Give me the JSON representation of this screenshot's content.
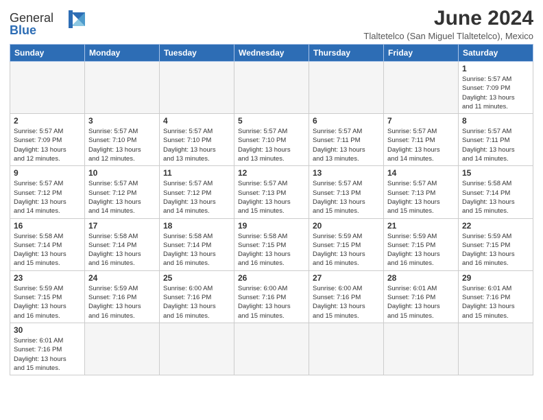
{
  "header": {
    "logo_text_general": "General",
    "logo_text_blue": "Blue",
    "month_year": "June 2024",
    "location": "Tlaltetelco (San Miguel Tlaltetelco), Mexico"
  },
  "weekdays": [
    "Sunday",
    "Monday",
    "Tuesday",
    "Wednesday",
    "Thursday",
    "Friday",
    "Saturday"
  ],
  "weeks": [
    [
      {
        "day": "",
        "info": ""
      },
      {
        "day": "",
        "info": ""
      },
      {
        "day": "",
        "info": ""
      },
      {
        "day": "",
        "info": ""
      },
      {
        "day": "",
        "info": ""
      },
      {
        "day": "",
        "info": ""
      },
      {
        "day": "1",
        "info": "Sunrise: 5:57 AM\nSunset: 7:09 PM\nDaylight: 13 hours\nand 11 minutes."
      }
    ],
    [
      {
        "day": "2",
        "info": "Sunrise: 5:57 AM\nSunset: 7:09 PM\nDaylight: 13 hours\nand 12 minutes."
      },
      {
        "day": "3",
        "info": "Sunrise: 5:57 AM\nSunset: 7:10 PM\nDaylight: 13 hours\nand 12 minutes."
      },
      {
        "day": "4",
        "info": "Sunrise: 5:57 AM\nSunset: 7:10 PM\nDaylight: 13 hours\nand 13 minutes."
      },
      {
        "day": "5",
        "info": "Sunrise: 5:57 AM\nSunset: 7:10 PM\nDaylight: 13 hours\nand 13 minutes."
      },
      {
        "day": "6",
        "info": "Sunrise: 5:57 AM\nSunset: 7:11 PM\nDaylight: 13 hours\nand 13 minutes."
      },
      {
        "day": "7",
        "info": "Sunrise: 5:57 AM\nSunset: 7:11 PM\nDaylight: 13 hours\nand 14 minutes."
      },
      {
        "day": "8",
        "info": "Sunrise: 5:57 AM\nSunset: 7:11 PM\nDaylight: 13 hours\nand 14 minutes."
      }
    ],
    [
      {
        "day": "9",
        "info": "Sunrise: 5:57 AM\nSunset: 7:12 PM\nDaylight: 13 hours\nand 14 minutes."
      },
      {
        "day": "10",
        "info": "Sunrise: 5:57 AM\nSunset: 7:12 PM\nDaylight: 13 hours\nand 14 minutes."
      },
      {
        "day": "11",
        "info": "Sunrise: 5:57 AM\nSunset: 7:12 PM\nDaylight: 13 hours\nand 14 minutes."
      },
      {
        "day": "12",
        "info": "Sunrise: 5:57 AM\nSunset: 7:13 PM\nDaylight: 13 hours\nand 15 minutes."
      },
      {
        "day": "13",
        "info": "Sunrise: 5:57 AM\nSunset: 7:13 PM\nDaylight: 13 hours\nand 15 minutes."
      },
      {
        "day": "14",
        "info": "Sunrise: 5:57 AM\nSunset: 7:13 PM\nDaylight: 13 hours\nand 15 minutes."
      },
      {
        "day": "15",
        "info": "Sunrise: 5:58 AM\nSunset: 7:14 PM\nDaylight: 13 hours\nand 15 minutes."
      }
    ],
    [
      {
        "day": "16",
        "info": "Sunrise: 5:58 AM\nSunset: 7:14 PM\nDaylight: 13 hours\nand 15 minutes."
      },
      {
        "day": "17",
        "info": "Sunrise: 5:58 AM\nSunset: 7:14 PM\nDaylight: 13 hours\nand 16 minutes."
      },
      {
        "day": "18",
        "info": "Sunrise: 5:58 AM\nSunset: 7:14 PM\nDaylight: 13 hours\nand 16 minutes."
      },
      {
        "day": "19",
        "info": "Sunrise: 5:58 AM\nSunset: 7:15 PM\nDaylight: 13 hours\nand 16 minutes."
      },
      {
        "day": "20",
        "info": "Sunrise: 5:59 AM\nSunset: 7:15 PM\nDaylight: 13 hours\nand 16 minutes."
      },
      {
        "day": "21",
        "info": "Sunrise: 5:59 AM\nSunset: 7:15 PM\nDaylight: 13 hours\nand 16 minutes."
      },
      {
        "day": "22",
        "info": "Sunrise: 5:59 AM\nSunset: 7:15 PM\nDaylight: 13 hours\nand 16 minutes."
      }
    ],
    [
      {
        "day": "23",
        "info": "Sunrise: 5:59 AM\nSunset: 7:15 PM\nDaylight: 13 hours\nand 16 minutes."
      },
      {
        "day": "24",
        "info": "Sunrise: 5:59 AM\nSunset: 7:16 PM\nDaylight: 13 hours\nand 16 minutes."
      },
      {
        "day": "25",
        "info": "Sunrise: 6:00 AM\nSunset: 7:16 PM\nDaylight: 13 hours\nand 16 minutes."
      },
      {
        "day": "26",
        "info": "Sunrise: 6:00 AM\nSunset: 7:16 PM\nDaylight: 13 hours\nand 15 minutes."
      },
      {
        "day": "27",
        "info": "Sunrise: 6:00 AM\nSunset: 7:16 PM\nDaylight: 13 hours\nand 15 minutes."
      },
      {
        "day": "28",
        "info": "Sunrise: 6:01 AM\nSunset: 7:16 PM\nDaylight: 13 hours\nand 15 minutes."
      },
      {
        "day": "29",
        "info": "Sunrise: 6:01 AM\nSunset: 7:16 PM\nDaylight: 13 hours\nand 15 minutes."
      }
    ],
    [
      {
        "day": "30",
        "info": "Sunrise: 6:01 AM\nSunset: 7:16 PM\nDaylight: 13 hours\nand 15 minutes."
      },
      {
        "day": "",
        "info": ""
      },
      {
        "day": "",
        "info": ""
      },
      {
        "day": "",
        "info": ""
      },
      {
        "day": "",
        "info": ""
      },
      {
        "day": "",
        "info": ""
      },
      {
        "day": "",
        "info": ""
      }
    ]
  ]
}
